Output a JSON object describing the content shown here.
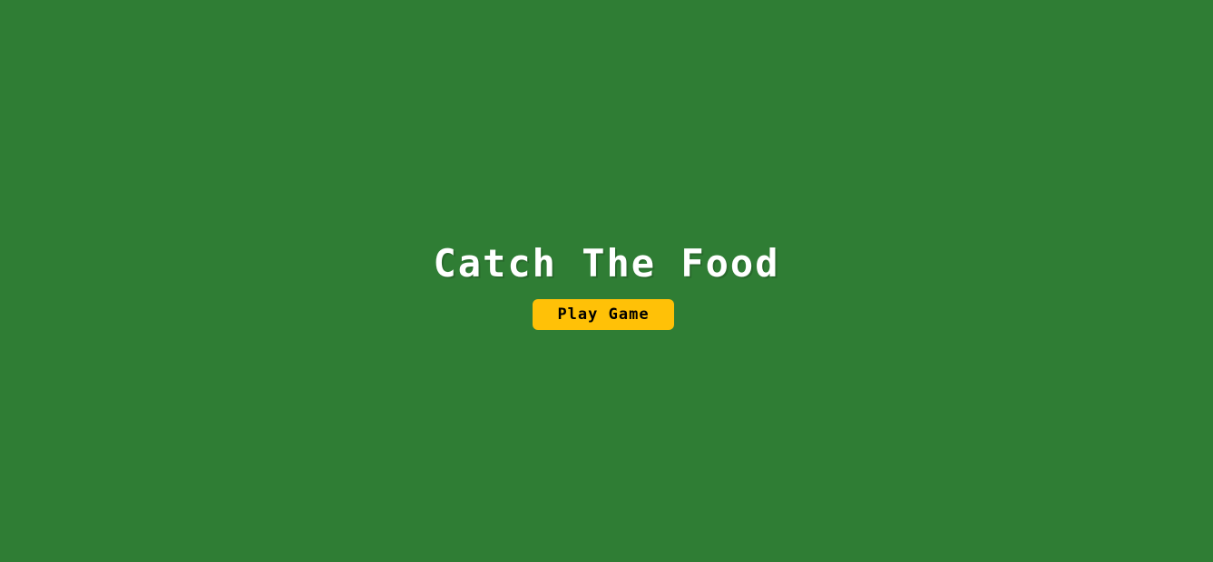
{
  "game": {
    "title": "Catch The Food",
    "play_button_label": "Play Game"
  },
  "colors": {
    "background": "#2f7d34",
    "title_text": "#ffffff",
    "button_background": "#ffc107",
    "button_text": "#000000"
  }
}
